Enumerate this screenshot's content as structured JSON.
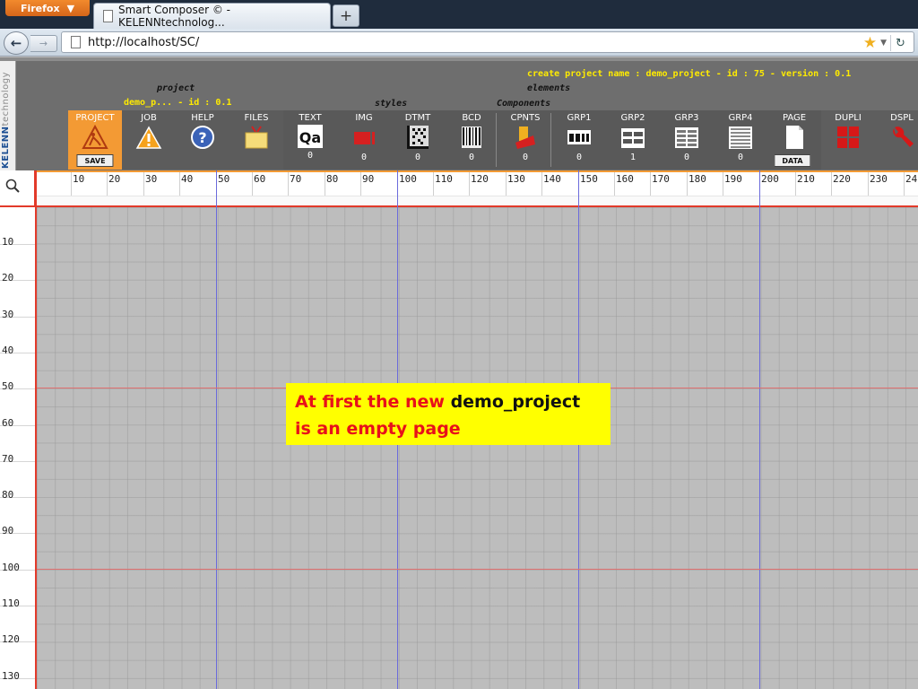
{
  "browser": {
    "menu_button": "Firefox",
    "tab_title": "Smart Composer © - KELENNtechnolog...",
    "new_tab": "+",
    "url": "http://localhost/SC/"
  },
  "app": {
    "logo_brand": "KELENN",
    "logo_suffix": "technology",
    "project_title": "project",
    "project_name": "demo_p... - id : 0.1",
    "styles_title": "styles",
    "components_title": "Components",
    "create_info": "create project name : demo_project - id : 75 - version : 0.1",
    "elements_title": "elements",
    "buttons": [
      {
        "label": "PROJECT",
        "sub": "SAVE"
      },
      {
        "label": "JOB"
      },
      {
        "label": "HELP"
      },
      {
        "label": "FILES"
      },
      {
        "label": "TEXT",
        "icon_text": "Qa",
        "count": "0"
      },
      {
        "label": "IMG",
        "count": "0"
      },
      {
        "label": "DTMT",
        "count": "0"
      },
      {
        "label": "BCD",
        "count": "0"
      },
      {
        "label": "CPNTS",
        "count": "0"
      },
      {
        "label": "GRP1",
        "count": "0"
      },
      {
        "label": "GRP2",
        "count": "1"
      },
      {
        "label": "GRP3",
        "count": "0"
      },
      {
        "label": "GRP4",
        "count": "0"
      },
      {
        "label": "PAGE",
        "sub": "DATA"
      },
      {
        "label": "DUPLI"
      },
      {
        "label": "DSPL"
      }
    ]
  },
  "ruler": {
    "top": [
      "10",
      "20",
      "30",
      "40",
      "50",
      "60",
      "70",
      "80",
      "90",
      "100",
      "110",
      "120",
      "130",
      "140",
      "150",
      "160",
      "170",
      "180",
      "190",
      "200",
      "210",
      "220",
      "230",
      "24"
    ],
    "left": [
      "10",
      "20",
      "30",
      "40",
      "50",
      "60",
      "70",
      "80",
      "90",
      "100",
      "110",
      "120",
      "130"
    ]
  },
  "note": {
    "part1": "At first the new ",
    "highlight": "demo_project",
    "part2": " is an empty page"
  },
  "colors": {
    "accent": "#f39a34",
    "header_text": "#ffeb00",
    "note_bg": "#ffff00",
    "note_text": "#e8101a"
  }
}
